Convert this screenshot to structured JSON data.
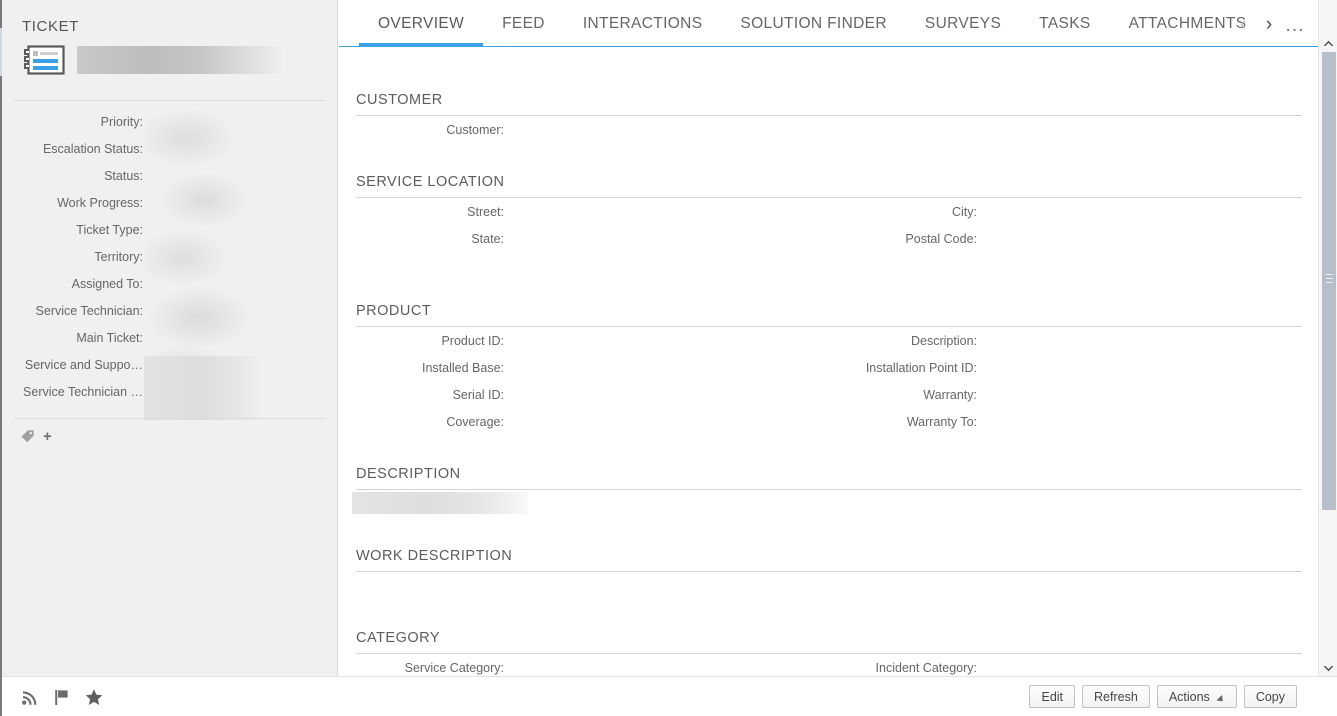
{
  "sidebar": {
    "title": "TICKET",
    "ticket_icon": "ticket-icon",
    "ticket_name": "",
    "fields": [
      {
        "label": "Priority:",
        "value": ""
      },
      {
        "label": "Escalation Status:",
        "value": ""
      },
      {
        "label": "Status:",
        "value": ""
      },
      {
        "label": "Work Progress:",
        "value": ""
      },
      {
        "label": "Ticket Type:",
        "value": ""
      },
      {
        "label": "Territory:",
        "value": ""
      },
      {
        "label": "Assigned To:",
        "value": ""
      },
      {
        "label": "Service Technician:",
        "value": ""
      },
      {
        "label": "Main Ticket:",
        "value": ""
      },
      {
        "label": "Service and Suppo…",
        "value": ""
      },
      {
        "label": "Service Technician …",
        "value": ""
      }
    ],
    "tag": {
      "icon": "tag-icon",
      "add_label": "+"
    }
  },
  "tabs": [
    {
      "label": "OVERVIEW",
      "active": true
    },
    {
      "label": "FEED",
      "active": false
    },
    {
      "label": "INTERACTIONS",
      "active": false
    },
    {
      "label": "SOLUTION FINDER",
      "active": false
    },
    {
      "label": "SURVEYS",
      "active": false
    },
    {
      "label": "TASKS",
      "active": false
    },
    {
      "label": "ATTACHMENTS",
      "active": false
    }
  ],
  "tab_nav": {
    "prev": "‹",
    "next": "›",
    "more": "…"
  },
  "sections": [
    {
      "title": "CUSTOMER",
      "fields_left": [
        "Customer:"
      ],
      "fields_right": []
    },
    {
      "title": "SERVICE LOCATION",
      "fields_left": [
        "Street:",
        "State:"
      ],
      "fields_right": [
        "City:",
        "Postal Code:"
      ]
    },
    {
      "title": "PRODUCT",
      "fields_left": [
        "Product ID:",
        "Installed Base:",
        "Serial ID:",
        "Coverage:"
      ],
      "fields_right": [
        "Description:",
        "Installation Point ID:",
        "Warranty:",
        "Warranty To:"
      ]
    },
    {
      "title": "DESCRIPTION",
      "fields_left": [],
      "fields_right": []
    },
    {
      "title": "WORK DESCRIPTION",
      "fields_left": [],
      "fields_right": []
    },
    {
      "title": "CATEGORY",
      "fields_left": [
        "Service Category:"
      ],
      "fields_right": [
        "Incident Category:"
      ]
    }
  ],
  "footer": {
    "icons": [
      "feed-icon",
      "flag-icon",
      "star-icon"
    ],
    "buttons": [
      {
        "label": "Edit",
        "dropdown": false
      },
      {
        "label": "Refresh",
        "dropdown": false
      },
      {
        "label": "Actions",
        "dropdown": true
      },
      {
        "label": "Copy",
        "dropdown": false
      }
    ]
  },
  "scrollbar": {
    "up_arrow": "▲",
    "down_arrow": "▼"
  },
  "colors": {
    "accent": "#3ca0e8",
    "sidebar_bg": "#f0f0f0",
    "content_bg": "#ffffff",
    "label_text": "#666666",
    "scroll_thumb": "#b6bfc9"
  }
}
